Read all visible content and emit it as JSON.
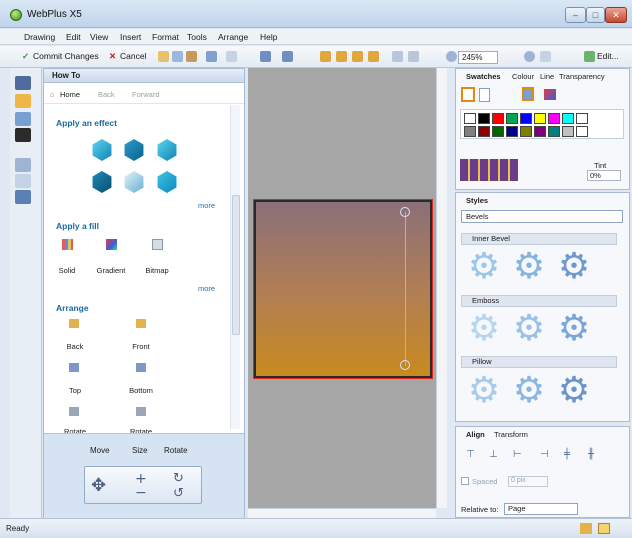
{
  "window": {
    "title": "WebPlus X5",
    "controls": [
      "–",
      "□",
      "✕"
    ]
  },
  "menu": [
    "Drawing",
    "Edit",
    "View",
    "Insert",
    "Format",
    "Tools",
    "Arrange",
    "Help"
  ],
  "toolbar": {
    "commit": "Commit Changes",
    "cancel": "Cancel",
    "zoom": "245%",
    "edit": "Edit..."
  },
  "howto": {
    "title": "How To",
    "nav": {
      "home": "Home",
      "back": "Back",
      "forward": "Forward"
    },
    "effect_heading": "Apply an effect",
    "fill_heading": "Apply a fill",
    "fills": [
      "Solid",
      "Gradient",
      "Bitmap"
    ],
    "arrange_heading": "Arrange",
    "arrange_items": [
      "Back",
      "Front",
      "Top",
      "Bottom",
      "Rotate",
      "Rotate"
    ],
    "more": "more",
    "transform_tabs": [
      "Move",
      "Size",
      "Rotate"
    ]
  },
  "swatches": {
    "tabs": [
      "Swatches",
      "Colour",
      "Line",
      "Transparency"
    ],
    "tint_label": "Tint",
    "tint_value": "0%",
    "colors": [
      "#ffffff",
      "#000000",
      "#ff0000",
      "#00a651",
      "#0000ff",
      "#ffff00",
      "#ff00ff",
      "#00ffff",
      "#ffffff",
      "#808080",
      "#8b0000",
      "#006400",
      "#00008b",
      "#808000",
      "#800080",
      "#008080",
      "#c0c0c0",
      "#ffffff"
    ]
  },
  "styles": {
    "title": "Styles",
    "selected": "Bevels",
    "categories": [
      "Inner Bevel",
      "Emboss",
      "Pillow"
    ]
  },
  "align": {
    "tabs": [
      "Align",
      "Transform"
    ],
    "spaced_label": "Spaced",
    "spaced_value": "0 pix",
    "relative_label": "Relative to:",
    "relative_value": "Page"
  },
  "status": {
    "text": "Ready"
  }
}
